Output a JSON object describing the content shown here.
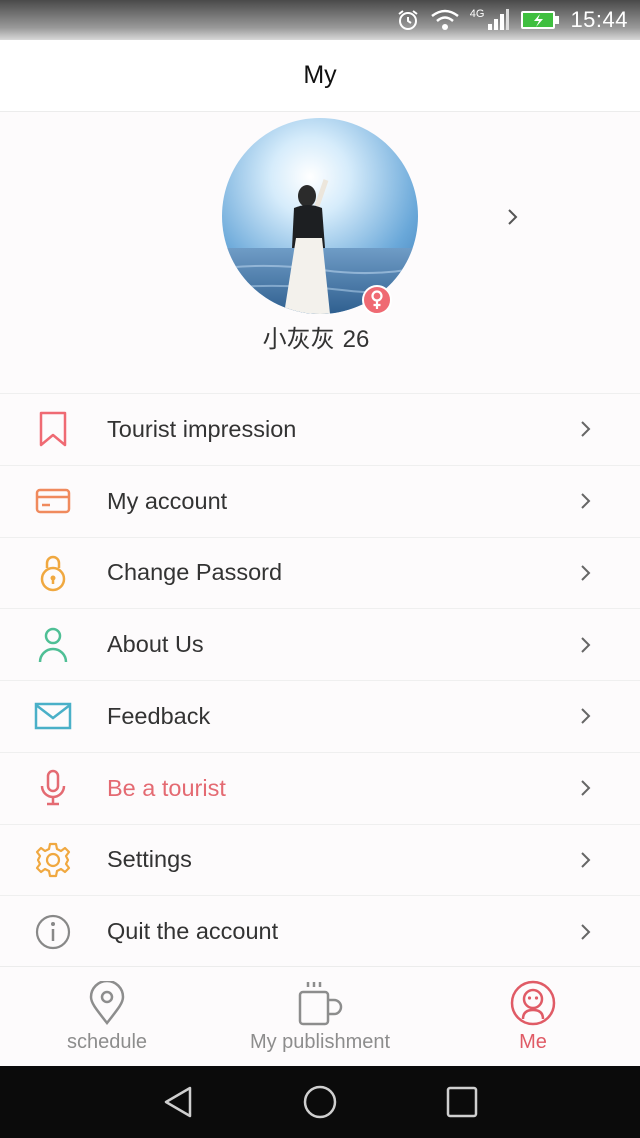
{
  "status_bar": {
    "network": "4G",
    "time": "15:44"
  },
  "header": {
    "title": "My"
  },
  "profile": {
    "name": "小灰灰",
    "age": "26"
  },
  "menu": {
    "items": [
      {
        "label": "Tourist impression",
        "icon": "bookmark-icon",
        "color": "#ef6a73"
      },
      {
        "label": "My account",
        "icon": "card-icon",
        "color": "#f08a5d"
      },
      {
        "label": "Change Passord",
        "icon": "lock-icon",
        "color": "#f0a840"
      },
      {
        "label": "About Us",
        "icon": "person-icon",
        "color": "#4fbf95"
      },
      {
        "label": "Feedback",
        "icon": "envelope-icon",
        "color": "#4ab0c8"
      },
      {
        "label": "Be a tourist",
        "icon": "microphone-icon",
        "color": "#e46a72"
      },
      {
        "label": "Settings",
        "icon": "gear-icon",
        "color": "#f0a840"
      },
      {
        "label": "Quit the account",
        "icon": "info-icon",
        "color": "#888888"
      }
    ]
  },
  "bottom_nav": {
    "items": [
      {
        "label": "schedule",
        "icon": "location-pin-icon"
      },
      {
        "label": "My publishment",
        "icon": "coffee-cup-icon"
      },
      {
        "label": "Me",
        "icon": "person-face-icon"
      }
    ],
    "active_index": 2
  },
  "colors": {
    "accent": "#e05b66",
    "background": "#fdfbfc",
    "text": "#333333",
    "muted": "#8d8d8d"
  }
}
